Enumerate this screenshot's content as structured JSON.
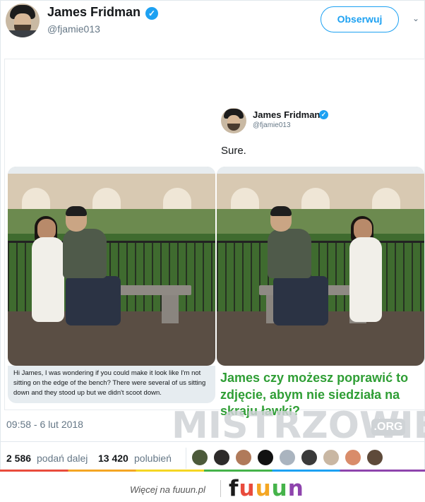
{
  "author": {
    "name": "James Fridman",
    "handle": "@fjamie013",
    "verified_glyph": "✓"
  },
  "follow_button": {
    "label": "Obserwuj"
  },
  "menu_glyph": "⌄",
  "embedded_tweet": {
    "name": "James Fridman",
    "handle": "@fjamie013",
    "verified_glyph": "✓",
    "reply": "Sure."
  },
  "request_message": "Hi James, I was wondering if you could make it look like I'm not sitting on the edge of the bench? There were several of us sitting down and they stood up but we didn't scoot down.",
  "caption": "James czy możesz poprawić to zdjęcie, abym nie siedziała na skraju ławki?",
  "watermark": {
    "text": "MISTRZOWIE",
    "suffix": ".ORG"
  },
  "timestamp": "09:58 - 6 lut 2018",
  "stats": {
    "retweets_count": "2 586",
    "retweets_label": "podań dalej",
    "likes_count": "13 420",
    "likes_label": "polubień"
  },
  "liker_colors": [
    "#4c5a3a",
    "#2d2b2a",
    "#b07a5a",
    "#111111",
    "#aab4bf",
    "#3a3a3a",
    "#c9b7a3",
    "#d98c6a",
    "#5e4a3a"
  ],
  "footer": {
    "text": "Więcej na fuuun.pl",
    "logo_letters": [
      "f",
      "u",
      "u",
      "u",
      "n"
    ],
    "logo_colors": [
      "#1a1a1a",
      "#e94b3c",
      "#f4a623",
      "#45b34a",
      "#8e44ad"
    ]
  },
  "colors": {
    "accent": "#1da1f2",
    "caption_green": "#2f9e35",
    "muted": "#657786"
  }
}
